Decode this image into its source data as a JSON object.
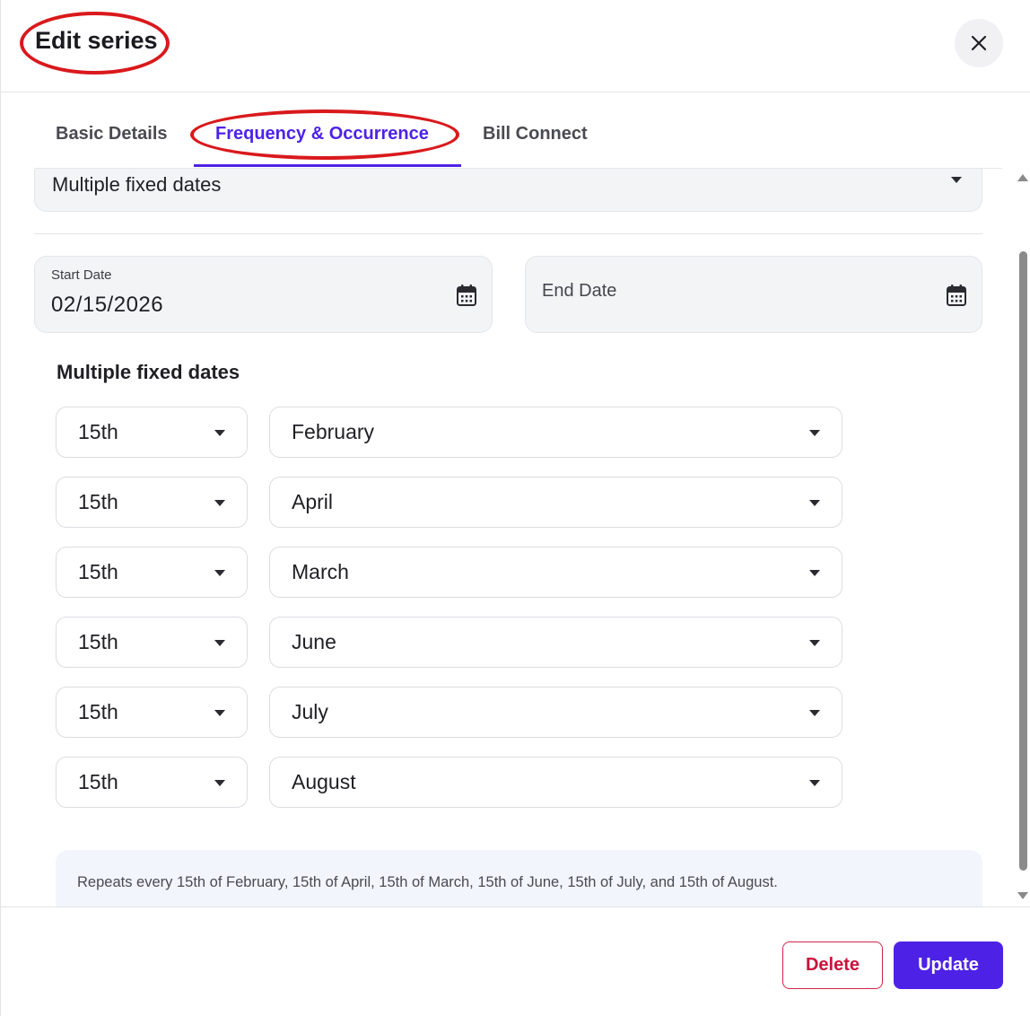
{
  "header": {
    "title": "Edit series",
    "close_icon": "close-icon"
  },
  "tabs": [
    {
      "label": "Basic Details",
      "active": false
    },
    {
      "label": "Frequency & Occurrence",
      "active": true
    },
    {
      "label": "Bill Connect",
      "active": false
    }
  ],
  "frequency": {
    "selected": "Multiple fixed dates"
  },
  "dates": {
    "start_label": "Start Date",
    "start_value": "02/15/2026",
    "end_placeholder": "End Date"
  },
  "fixed_dates": {
    "title": "Multiple fixed dates",
    "rows": [
      {
        "day": "15th",
        "month": "February"
      },
      {
        "day": "15th",
        "month": "April"
      },
      {
        "day": "15th",
        "month": "March"
      },
      {
        "day": "15th",
        "month": "June"
      },
      {
        "day": "15th",
        "month": "July"
      },
      {
        "day": "15th",
        "month": "August"
      }
    ]
  },
  "summary": "Repeats every 15th of February, 15th of April, 15th of March, 15th of June, 15th of July, and 15th of August.",
  "footer": {
    "delete_label": "Delete",
    "update_label": "Update"
  },
  "colors": {
    "accent": "#4d22e6",
    "danger": "#c8133b",
    "annotation": "#d9191c"
  }
}
